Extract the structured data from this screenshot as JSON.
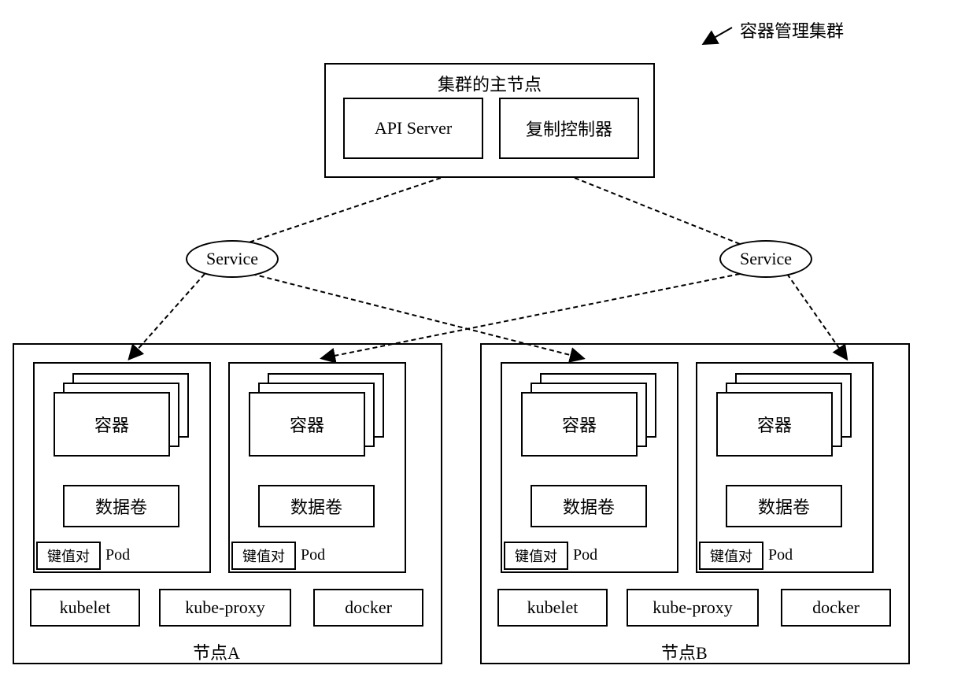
{
  "title": {
    "cluster_label": "容器管理集群"
  },
  "master": {
    "title": "集群的主节点",
    "api_server": "API Server",
    "replication_controller": "复制控制器"
  },
  "services": {
    "service1": "Service",
    "service2": "Service"
  },
  "nodeA": {
    "name": "节点A",
    "pods": {
      "pod1": {
        "container": "容器",
        "volume": "数据卷",
        "kvpair": "键值对",
        "pod_label": "Pod"
      },
      "pod2": {
        "container": "容器",
        "volume": "数据卷",
        "kvpair": "键值对",
        "pod_label": "Pod"
      }
    },
    "components": {
      "kubelet": "kubelet",
      "kube_proxy": "kube-proxy",
      "docker": "docker"
    }
  },
  "nodeB": {
    "name": "节点B",
    "pods": {
      "pod1": {
        "container": "容器",
        "volume": "数据卷",
        "kvpair": "键值对",
        "pod_label": "Pod"
      },
      "pod2": {
        "container": "容器",
        "volume": "数据卷",
        "kvpair": "键值对",
        "pod_label": "Pod"
      }
    },
    "components": {
      "kubelet": "kubelet",
      "kube_proxy": "kube-proxy",
      "docker": "docker"
    }
  }
}
